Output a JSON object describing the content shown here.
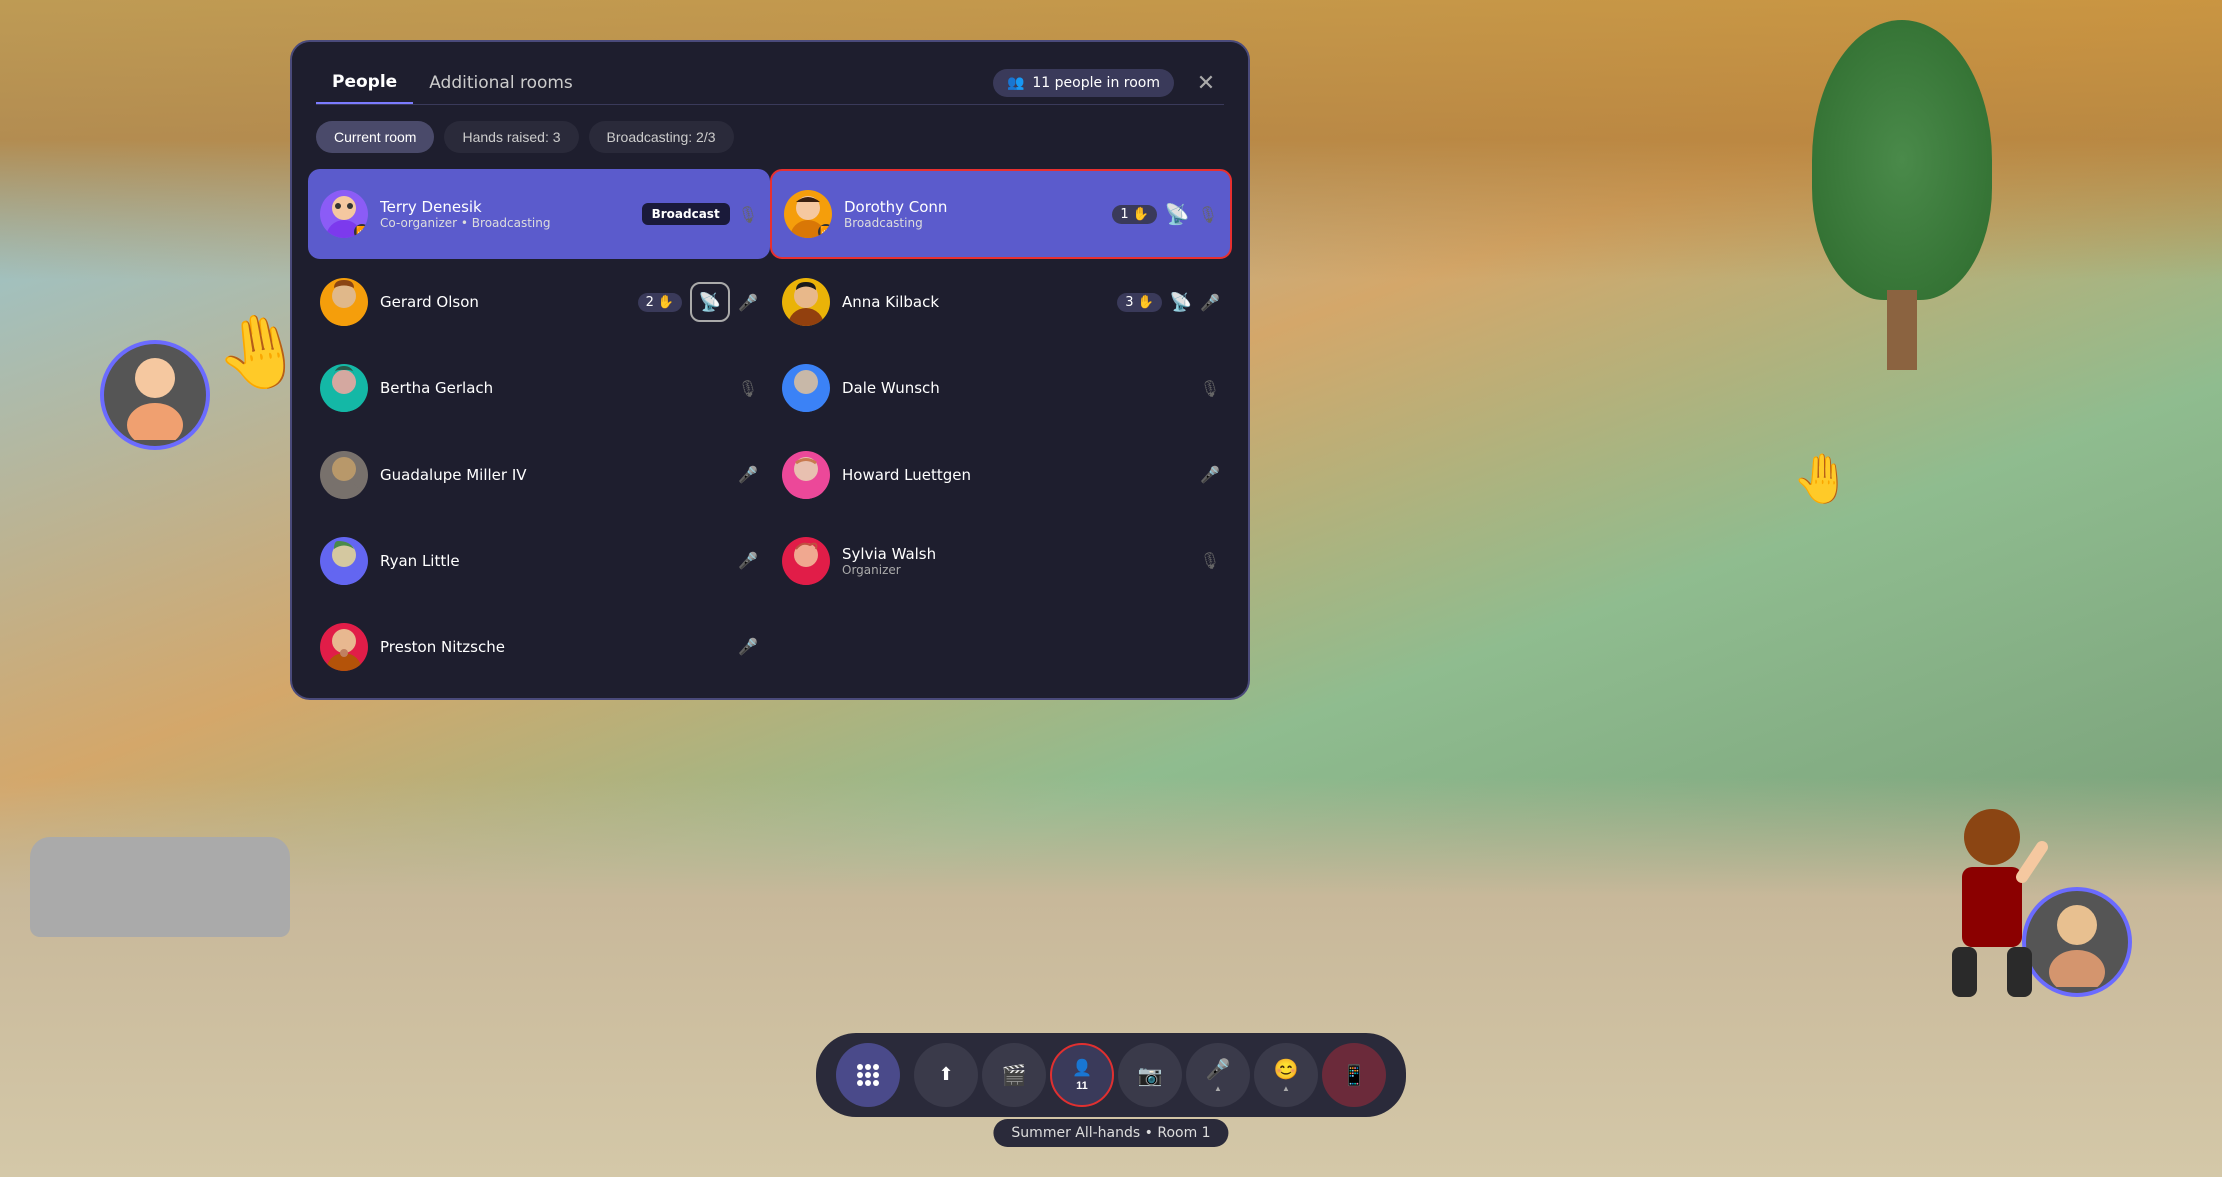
{
  "background": {
    "color": "#87ceeb"
  },
  "panel": {
    "tabs": [
      {
        "id": "people",
        "label": "People",
        "active": true
      },
      {
        "id": "rooms",
        "label": "Additional rooms",
        "active": false
      }
    ],
    "people_count_label": "11 people in room",
    "close_label": "×",
    "filters": [
      {
        "id": "current-room",
        "label": "Current room",
        "active": true
      },
      {
        "id": "hands-raised",
        "label": "Hands raised: 3",
        "active": false
      },
      {
        "id": "broadcasting",
        "label": "Broadcasting: 2/3",
        "active": false
      }
    ],
    "people": [
      {
        "id": "terry",
        "name": "Terry Denesik",
        "role": "Co-organizer • Broadcasting",
        "avatar_color": "av-purple",
        "avatar_emoji": "👤",
        "broadcasting": true,
        "has_broadcast_btn": true,
        "broadcast_label": "Broadcast",
        "column": 0
      },
      {
        "id": "dorothy",
        "name": "Dorothy Conn",
        "role": "Broadcasting",
        "avatar_color": "av-orange",
        "avatar_emoji": "👤",
        "broadcasting": true,
        "highlighted": true,
        "hand_count": "1",
        "hand_emoji": "✋",
        "has_broadcast_icon": true,
        "column": 1
      },
      {
        "id": "gerard",
        "name": "Gerard Olson",
        "role": "",
        "avatar_color": "av-orange",
        "avatar_emoji": "👤",
        "hand_count": "2",
        "hand_emoji": "✋",
        "has_broadcast_icon": true,
        "has_mic": true,
        "column": 0
      },
      {
        "id": "anna",
        "name": "Anna Kilback",
        "role": "",
        "avatar_color": "av-yellow",
        "avatar_emoji": "👤",
        "hand_count": "3",
        "hand_emoji": "✋",
        "has_broadcast_icon": true,
        "has_mic": true,
        "column": 1
      },
      {
        "id": "bertha",
        "name": "Bertha Gerlach",
        "role": "",
        "avatar_color": "av-teal",
        "avatar_emoji": "👤",
        "mic_muted": true,
        "column": 0
      },
      {
        "id": "dale",
        "name": "Dale Wunsch",
        "role": "",
        "avatar_color": "av-blue",
        "avatar_emoji": "👤",
        "mic_muted": true,
        "column": 1
      },
      {
        "id": "guadalupe",
        "name": "Guadalupe Miller IV",
        "role": "",
        "avatar_color": "av-brown",
        "avatar_emoji": "👤",
        "has_mic": true,
        "column": 0
      },
      {
        "id": "howard",
        "name": "Howard Luettgen",
        "role": "",
        "avatar_color": "av-pink",
        "avatar_emoji": "👤",
        "has_mic": true,
        "column": 1
      },
      {
        "id": "ryan",
        "name": "Ryan Little",
        "role": "",
        "avatar_color": "av-indigo",
        "avatar_emoji": "👤",
        "has_mic": true,
        "column": 0
      },
      {
        "id": "sylvia",
        "name": "Sylvia Walsh",
        "role": "Organizer",
        "avatar_color": "av-rose",
        "avatar_emoji": "👤",
        "mic_muted": true,
        "column": 1
      },
      {
        "id": "preston",
        "name": "Preston Nitzsche",
        "role": "",
        "avatar_color": "av-rose",
        "avatar_emoji": "👤",
        "has_mic": true,
        "column": 0
      }
    ]
  },
  "toolbar": {
    "apps_icon": "⋯",
    "buttons": [
      {
        "id": "share",
        "icon": "⬆",
        "label": "",
        "type": "dark"
      },
      {
        "id": "camera",
        "icon": "🎬",
        "label": "",
        "type": "dark"
      },
      {
        "id": "people",
        "icon": "👤",
        "count": "11",
        "label": "",
        "type": "active-people"
      },
      {
        "id": "photo",
        "icon": "📷",
        "label": "",
        "type": "dark"
      },
      {
        "id": "mic",
        "icon": "🎤",
        "label": "",
        "type": "dark"
      },
      {
        "id": "emoji",
        "icon": "😊",
        "label": "",
        "type": "dark"
      },
      {
        "id": "screen",
        "icon": "📱",
        "label": "",
        "type": "dark-red"
      }
    ]
  },
  "room_label": "Summer All-hands • Room 1",
  "icons": {
    "people_group": "👥",
    "hand_raised": "✋",
    "mic": "🎤",
    "mic_muted": "🎙",
    "broadcast": "📡",
    "close": "✕"
  }
}
